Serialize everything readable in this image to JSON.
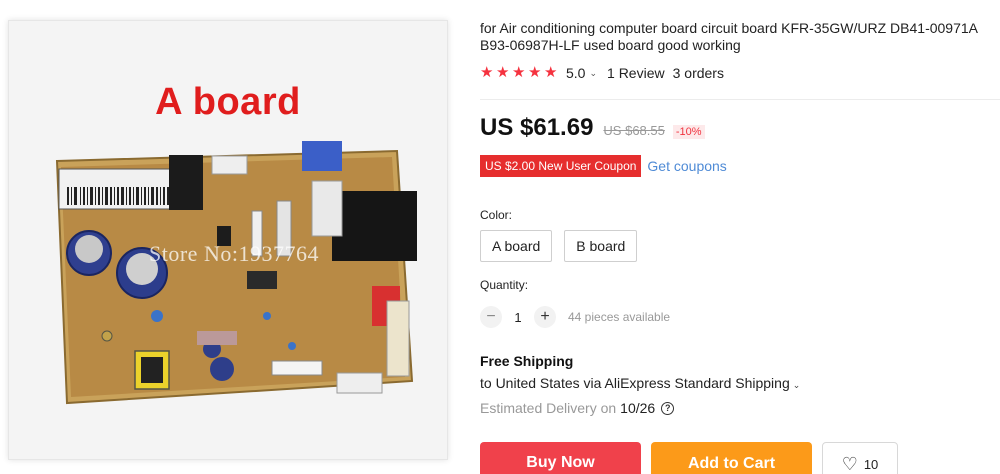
{
  "image": {
    "title": "A board",
    "watermark": "Store No:1937764"
  },
  "product": {
    "title": "for Air conditioning computer board circuit board KFR-35GW/URZ DB41-00971A B93-06987H-LF used board good working",
    "rating_value": "5.0",
    "reviews": "1 Review",
    "orders": "3 orders",
    "price": "US $61.69",
    "original_price": "US $68.55",
    "discount": "-10%",
    "coupon": "US $2.00 New User Coupon",
    "get_coupons": "Get coupons"
  },
  "options": {
    "color_label": "Color:",
    "colors": [
      "A board",
      "B board"
    ],
    "quantity_label": "Quantity:",
    "quantity": "1",
    "decrement": "−",
    "increment": "+",
    "available": "44 pieces available"
  },
  "shipping": {
    "title": "Free Shipping",
    "line": "to United States via AliExpress Standard Shipping",
    "estimated_label": "Estimated Delivery on",
    "date": "10/26"
  },
  "actions": {
    "buy_now": "Buy Now",
    "add_to_cart": "Add to Cart",
    "wishlist_count": "10"
  },
  "colors": {
    "star": "#f5323f",
    "buy": "#f0414b",
    "cart": "#fc9a19",
    "coupon": "#e62e2e",
    "link": "#4f8bd6"
  }
}
